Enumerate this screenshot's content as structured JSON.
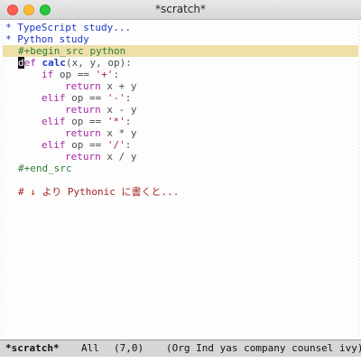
{
  "window": {
    "title": "*scratch*"
  },
  "editor": {
    "headings": [
      {
        "bullet": "*",
        "text": "TypeScript study..."
      },
      {
        "bullet": "*",
        "text": "Python study"
      }
    ],
    "src_begin": {
      "cursor_char": "#",
      "rest": "+begin_src python"
    },
    "code": {
      "def_cursor": "d",
      "def_rest": "ef",
      "fn_name": "calc",
      "fn_args": "(x, y, op):",
      "if1": "if",
      "op1_pre": " op == ",
      "op1_str": "'+'",
      "colon": ":",
      "ret": "return",
      "ret1": " x + y",
      "elif": "elif",
      "op2_str": "'-'",
      "ret2": " x - y",
      "op3_str": "'*'",
      "ret3": " x * y",
      "op4_str": "'/'",
      "ret4": " x / y",
      "op_pre": " op == "
    },
    "src_end": "#+end_src",
    "comment": "# ↓ より Pythonic に書くと..."
  },
  "modeline": {
    "buffer": "*scratch*",
    "position": "All",
    "cursor_pos": "(7,0)",
    "modes": "(Org Ind yas company counsel ivy)"
  }
}
